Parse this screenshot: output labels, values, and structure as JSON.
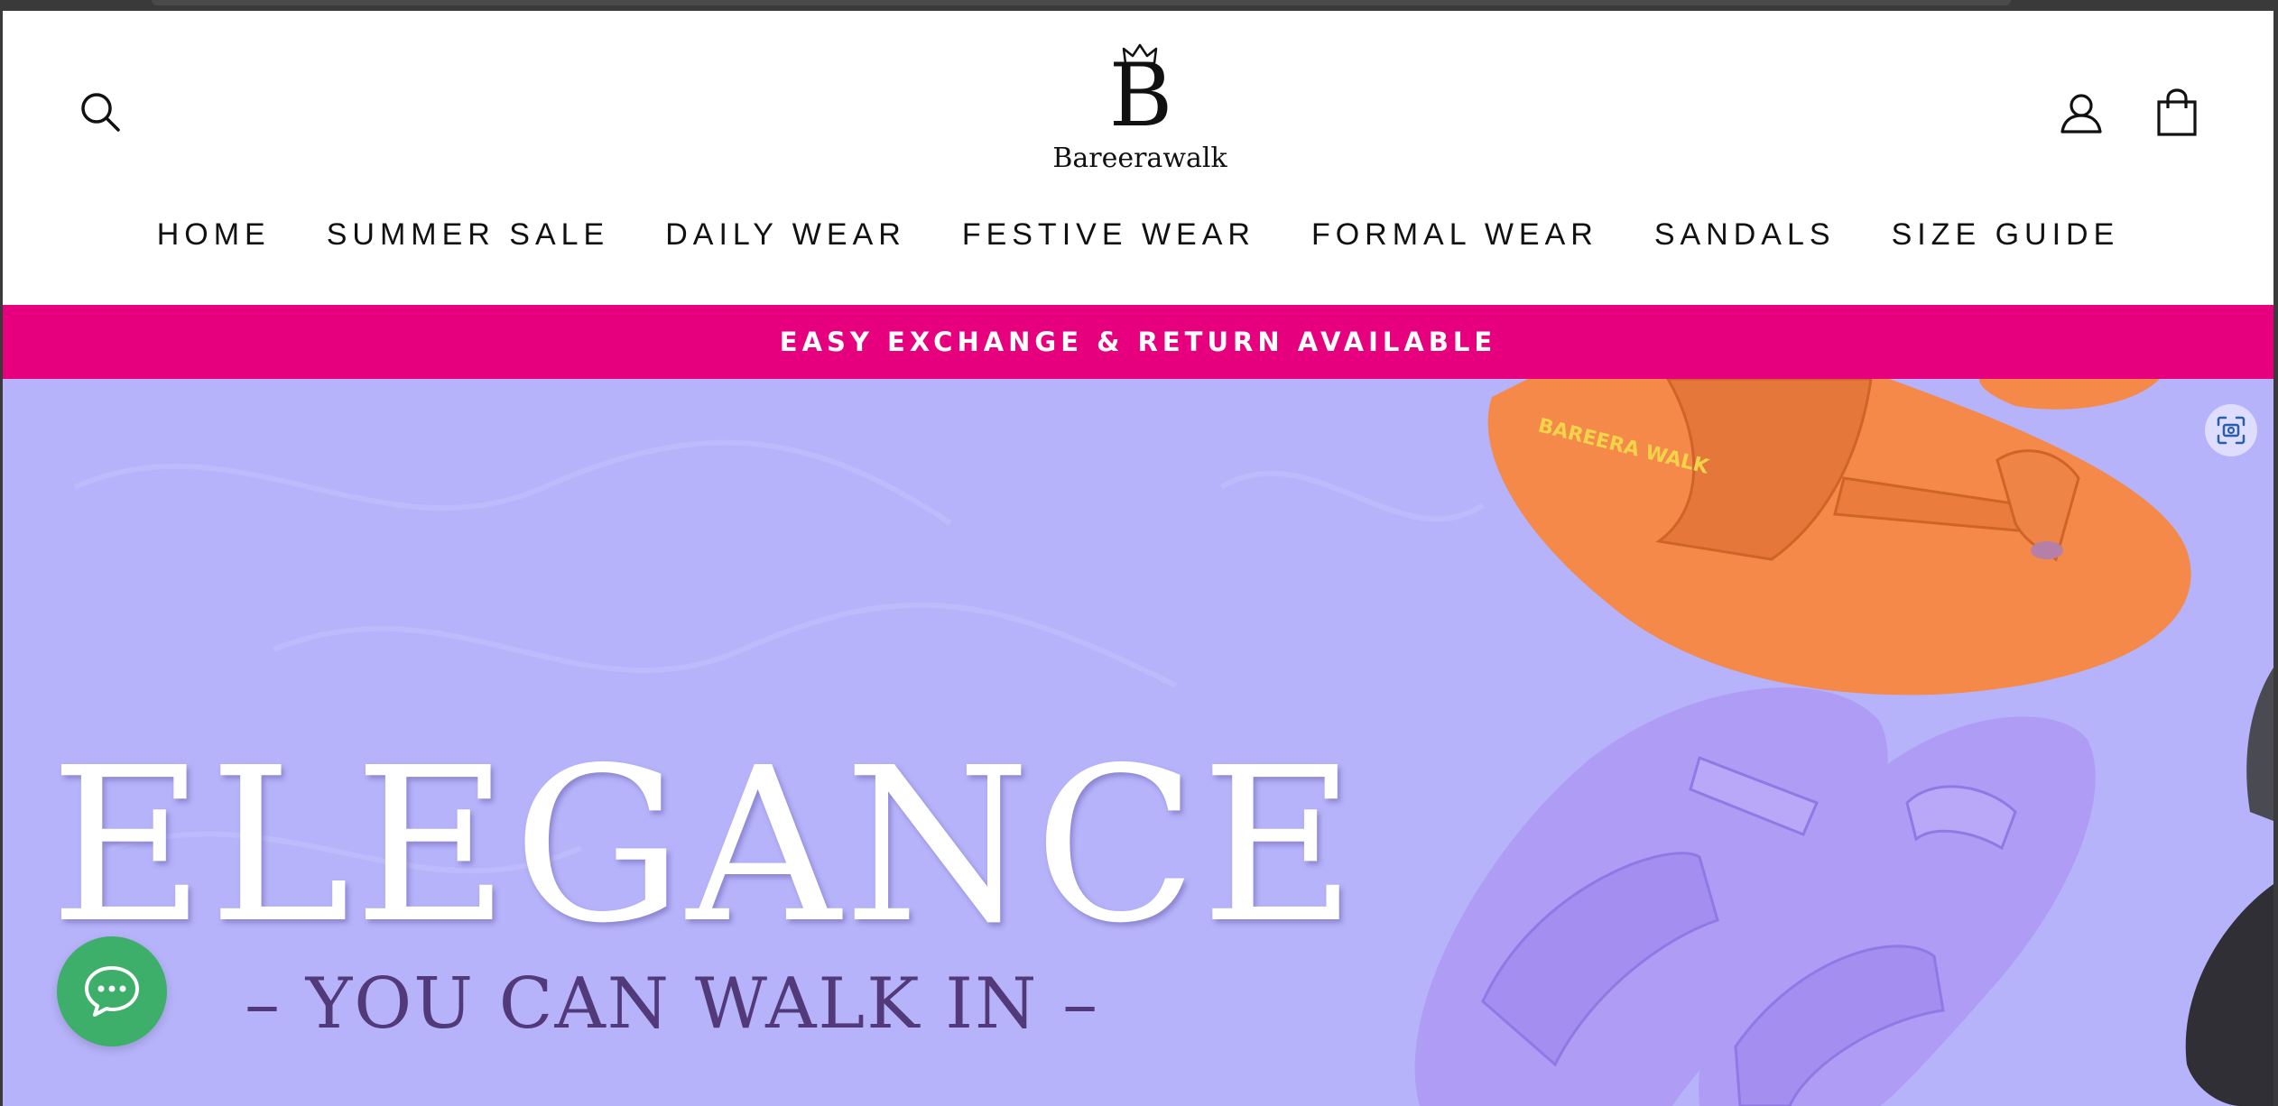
{
  "brand": {
    "monogram": "B",
    "name": "Bareerawalk"
  },
  "header": {
    "icons": {
      "search": "search-icon",
      "account": "account-icon",
      "cart": "shopping-bag-icon"
    }
  },
  "nav": {
    "items": [
      "HOME",
      "SUMMER SALE",
      "DAILY WEAR",
      "FESTIVE WEAR",
      "FORMAL WEAR",
      "SANDALS",
      "SIZE GUIDE"
    ]
  },
  "announcement": {
    "text": "EASY EXCHANGE & RETURN AVAILABLE",
    "color": "#e6007e"
  },
  "hero": {
    "headline": "ELEGANCE",
    "tagline": "– YOU CAN WALK IN –",
    "product_stamp": "BAREERA WALK",
    "background_color": "#b6b3fa",
    "sandal_colors": [
      "#f4894a",
      "#ae9cf5"
    ],
    "scan_icon": "screen-capture-icon"
  },
  "chat": {
    "icon": "chat-bubble-icon",
    "color": "#3daf6a"
  }
}
